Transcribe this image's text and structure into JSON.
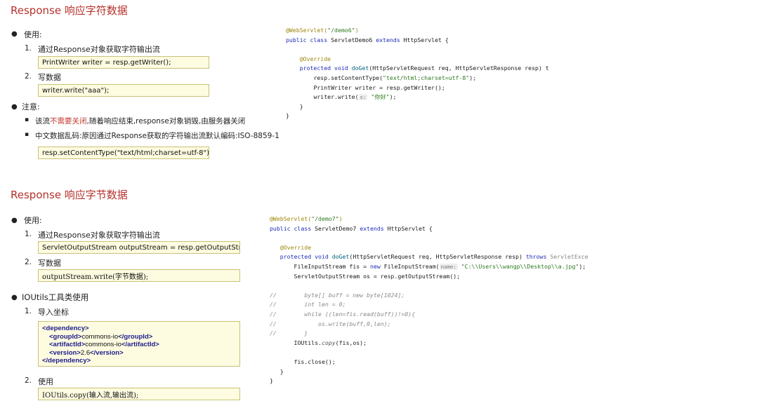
{
  "section1": {
    "title": "Response 响应字符数据",
    "use_label": "使用:",
    "step1_num": "1.",
    "step1": "通过Response对象获取字符输出流",
    "step1_code": "PrintWriter writer = resp.getWriter();",
    "step2_num": "2.",
    "step2": "写数据",
    "step2_code": "writer.write(\"aaa\");",
    "note_label": "注意:",
    "note1_a": "该流",
    "note1_b": "不需要关闭",
    "note1_c": ",随着响应结束,response对象销毁,由服务器关闭",
    "note2": "中文数据乱码:原因通过Response获取的字符输出流默认编码:ISO-8859-1",
    "note2_code": "resp.setContentType(\"text/html;charset=utf-8\");"
  },
  "code1": {
    "l1a": "@WebServlet(",
    "l1b": "\"/demo6\"",
    "l1c": ")",
    "l2a": "public class ",
    "l2b": "ServletDemo6 ",
    "l2c": "extends ",
    "l2d": "HttpServlet {",
    "l3": "@Override",
    "l4a": "protected void ",
    "l4b": "doGet",
    "l4c": "(HttpServletRequest req, HttpServletResponse resp) t",
    "l5a": "resp.setContentType(",
    "l5b": "\"text/html;charset=utf-8\"",
    "l5c": ");",
    "l6": "PrintWriter writer = resp.getWriter();",
    "l7a": "writer.write(",
    "l7hint": "s:",
    "l7b": "\"你好\"",
    "l7c": ");",
    "l8": "}",
    "l9": "}"
  },
  "section2": {
    "title": "Response 响应字节数据",
    "use_label": "使用:",
    "step1_num": "1.",
    "step1": "通过Response对象获取字符输出流",
    "step1_code": "ServletOutputStream outputStream = resp.getOutputStream();",
    "step2_num": "2.",
    "step2": "写数据",
    "step2_code": "outputStream.write(字节数据);",
    "ioutils_label": "IOUtils工具类使用",
    "io1_num": "1.",
    "io1": "导入坐标",
    "xml_dep_open": "<dependency>",
    "xml_g_open": "<groupId>",
    "xml_g_val": "commons-io",
    "xml_g_close": "</groupId>",
    "xml_a_open": "<artifactId>",
    "xml_a_val": "commons-io",
    "xml_a_close": "</artifactId>",
    "xml_v_open": "<version>",
    "xml_v_val": "2.6",
    "xml_v_close": "</version>",
    "xml_dep_close": "</dependency>",
    "io2_num": "2.",
    "io2": "使用",
    "io2_code": "IOUtils.copy(输入流,输出流);"
  },
  "code2": {
    "l1a": "@WebServlet(",
    "l1b": "\"/demo7\"",
    "l1c": ")",
    "l2a": "public class ",
    "l2b": "ServletDemo7 ",
    "l2c": "extends ",
    "l2d": "HttpServlet {",
    "l3": "@Override",
    "l4a": "protected void ",
    "l4b": "doGet",
    "l4c": "(HttpServletRequest req, HttpServletResponse resp) ",
    "l4d": "throws ",
    "l4e": "ServletExce",
    "l5a": "FileInputStream fis = ",
    "l5b": "new ",
    "l5c": "FileInputStream(",
    "l5hint": "name:",
    "l5d": "\"C:\\\\Users\\\\wangp\\\\Desktop\\\\a.jpg\"",
    "l5e": ");",
    "l6": "ServletOutputStream os = resp.getOutputStream();",
    "c1": "byte[] buff = new byte[1024];",
    "c2": "int len = 0;",
    "c3": "while ((len=fis.read(buff))!=0){",
    "c4": "os.write(buff,0,len);",
    "c5": "}",
    "l7a": "IOUtils.",
    "l7b": "copy",
    "l7c": "(fis,os);",
    "l8": "fis.close();",
    "l9": "}",
    "l10": "}",
    "g": "//"
  }
}
